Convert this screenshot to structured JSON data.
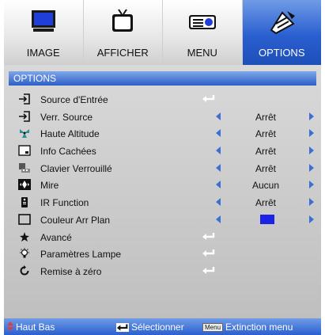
{
  "tabs": [
    {
      "label": "IMAGE",
      "icon": "monitor-icon"
    },
    {
      "label": "AFFICHER",
      "icon": "tv-icon"
    },
    {
      "label": "MENU",
      "icon": "projector-icon"
    },
    {
      "label": "OPTIONS",
      "icon": "tools-icon",
      "active": true
    }
  ],
  "section_title": "OPTIONS",
  "rows": [
    {
      "label": "Source d'Entrée",
      "icon": "input-source-icon"
    },
    {
      "label": "Verr. Source",
      "icon": "input-source-icon",
      "value": "Arrêt"
    },
    {
      "label": "Haute Altitude",
      "icon": "fan-icon",
      "value": "Arrêt"
    },
    {
      "label": "Info Cachées",
      "icon": "info-hide-icon",
      "value": "Arrêt"
    },
    {
      "label": "Clavier Verrouillé",
      "icon": "keypad-icon",
      "value": "Arrêt"
    },
    {
      "label": "Mire",
      "icon": "test-pattern-icon",
      "value": "Aucun"
    },
    {
      "label": "IR Function",
      "icon": "remote-icon",
      "value": "Arrêt"
    },
    {
      "label": "Couleur Arr Plan",
      "icon": "background-color-icon",
      "value_color": "#1a23e6"
    },
    {
      "label": "Avancé",
      "icon": "advanced-icon"
    },
    {
      "label": "Paramètres Lampe",
      "icon": "lamp-icon"
    },
    {
      "label": "Remise à zéro",
      "icon": "reset-icon"
    }
  ],
  "footer": {
    "navigate": "Haut Bas",
    "select": "Sélectionner",
    "menu_key": "Menu",
    "exit": "Extinction menu"
  }
}
